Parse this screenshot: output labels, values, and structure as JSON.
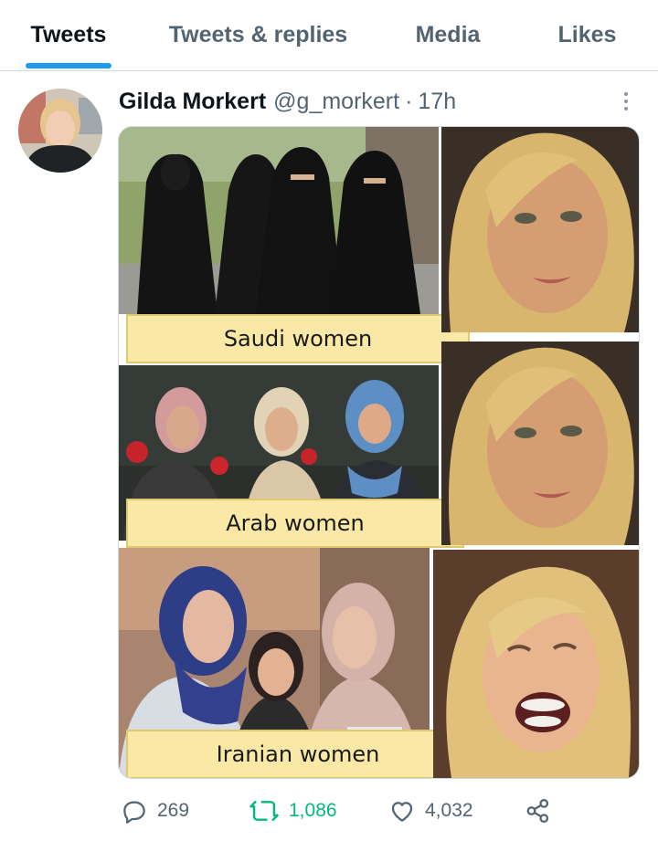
{
  "tabs": [
    {
      "label": "Tweets",
      "active": true
    },
    {
      "label": "Tweets & replies",
      "active": false
    },
    {
      "label": "Media",
      "active": false
    },
    {
      "label": "Likes",
      "active": false
    }
  ],
  "tweet": {
    "author_name": "Gilda Morkert",
    "author_handle": "@g_morkert",
    "separator": "·",
    "time": "17h",
    "more_icon": "more-dots-icon",
    "media": {
      "captions": [
        "Saudi women",
        "Arab women",
        "Iranian women"
      ]
    },
    "stats": {
      "replies": "269",
      "retweets": "1,086",
      "likes": "4,032"
    },
    "icons": {
      "reply": "reply-icon",
      "retweet": "retweet-icon",
      "like": "heart-icon",
      "share": "share-icon"
    }
  },
  "colors": {
    "accent": "#1d9bf0",
    "retweet_green": "#00ba7c",
    "muted": "#536471",
    "caption_bg": "#fae9a6"
  }
}
